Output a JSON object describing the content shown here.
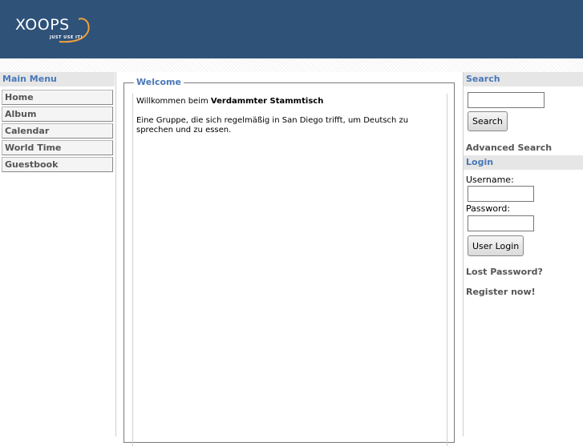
{
  "header": {
    "logo_text": "XOOPS",
    "logo_tagline": "JUST USE IT!"
  },
  "left": {
    "title": "Main Menu",
    "items": [
      {
        "label": "Home"
      },
      {
        "label": "Album"
      },
      {
        "label": "Calendar"
      },
      {
        "label": "World Time"
      },
      {
        "label": "Guestbook"
      }
    ]
  },
  "center": {
    "legend": "Welcome",
    "intro": "Willkommen beim ",
    "intro_bold": "Verdammter Stammtisch",
    "description": "Eine Gruppe, die sich regelmäßig in San Diego trifft, um Deutsch zu sprechen und zu essen."
  },
  "right": {
    "search": {
      "title": "Search",
      "input_value": "",
      "button_label": "Search",
      "advanced_link": "Advanced Search"
    },
    "login": {
      "title": "Login",
      "username_label": "Username:",
      "username_value": "",
      "password_label": "Password:",
      "password_value": "",
      "button_label": "User Login",
      "lost_password": "Lost Password?",
      "register": "Register now!"
    }
  },
  "colors": {
    "header_bg": "#2f5279",
    "block_title_text": "#4878b8",
    "block_title_bg": "#e6e6e6"
  }
}
